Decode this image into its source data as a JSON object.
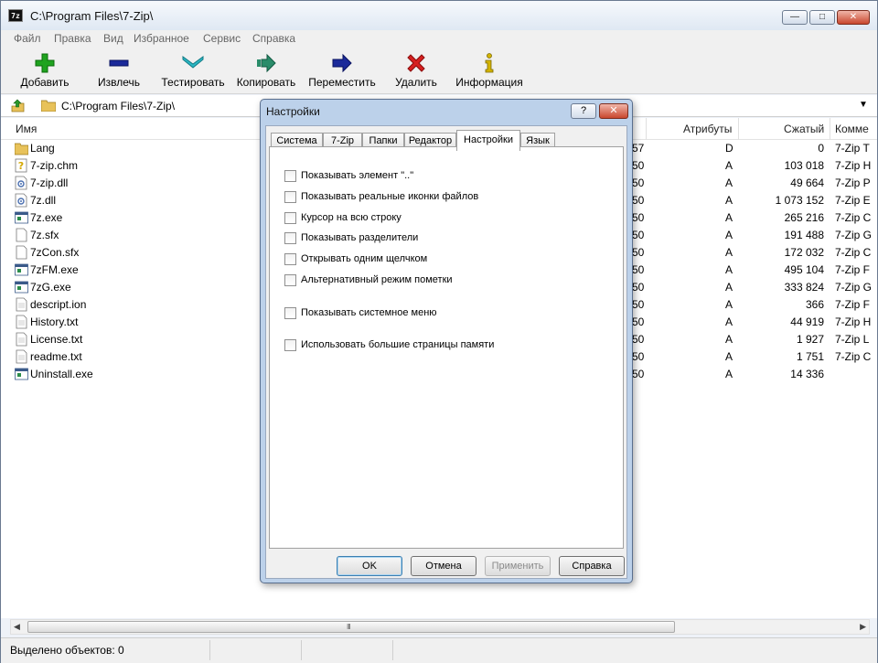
{
  "window": {
    "title": "C:\\Program Files\\7-Zip\\",
    "app_icon": "7z"
  },
  "menu": [
    "Файл",
    "Правка",
    "Вид",
    "Избранное",
    "Сервис",
    "Справка"
  ],
  "toolbar": [
    {
      "label": "Добавить",
      "icon": "plus-icon",
      "color": "#1fa31f"
    },
    {
      "label": "Извлечь",
      "icon": "minus-icon",
      "color": "#1b2a9a"
    },
    {
      "label": "Тестировать",
      "icon": "check-chevron-icon",
      "color": "#2bb7c4"
    },
    {
      "label": "Копировать",
      "icon": "copy-arrow-icon",
      "color": "#2a8c6a"
    },
    {
      "label": "Переместить",
      "icon": "move-arrow-icon",
      "color": "#1b2a9a"
    },
    {
      "label": "Удалить",
      "icon": "delete-x-icon",
      "color": "#d62020"
    },
    {
      "label": "Информация",
      "icon": "info-icon",
      "color": "#d4b400"
    }
  ],
  "address": {
    "path": "C:\\Program Files\\7-Zip\\"
  },
  "columns": {
    "name": "Имя",
    "attributes": "Атрибуты",
    "packed": "Сжатый",
    "comment": "Комме"
  },
  "files": [
    {
      "name": "Lang",
      "icon": "folder-icon",
      "modified": "57",
      "attr": "D",
      "size": "0",
      "comment": "7-Zip T"
    },
    {
      "name": "7-zip.chm",
      "icon": "help-file-icon",
      "modified": "50",
      "attr": "A",
      "size": "103 018",
      "comment": "7-Zip H"
    },
    {
      "name": "7-zip.dll",
      "icon": "dll-file-icon",
      "modified": "50",
      "attr": "A",
      "size": "49 664",
      "comment": "7-Zip P"
    },
    {
      "name": "7z.dll",
      "icon": "dll-file-icon",
      "modified": "50",
      "attr": "A",
      "size": "1 073 152",
      "comment": "7-Zip E"
    },
    {
      "name": "7z.exe",
      "icon": "exe-file-icon",
      "modified": "50",
      "attr": "A",
      "size": "265 216",
      "comment": "7-Zip C"
    },
    {
      "name": "7z.sfx",
      "icon": "blank-file-icon",
      "modified": "50",
      "attr": "A",
      "size": "191 488",
      "comment": "7-Zip G"
    },
    {
      "name": "7zCon.sfx",
      "icon": "blank-file-icon",
      "modified": "50",
      "attr": "A",
      "size": "172 032",
      "comment": "7-Zip C"
    },
    {
      "name": "7zFM.exe",
      "icon": "exe-file-icon",
      "modified": "50",
      "attr": "A",
      "size": "495 104",
      "comment": "7-Zip F"
    },
    {
      "name": "7zG.exe",
      "icon": "exe-file-icon",
      "modified": "50",
      "attr": "A",
      "size": "333 824",
      "comment": "7-Zip G"
    },
    {
      "name": "descript.ion",
      "icon": "text-file-icon",
      "modified": "50",
      "attr": "A",
      "size": "366",
      "comment": "7-Zip F"
    },
    {
      "name": "History.txt",
      "icon": "text-file-icon",
      "modified": "50",
      "attr": "A",
      "size": "44 919",
      "comment": "7-Zip H"
    },
    {
      "name": "License.txt",
      "icon": "text-file-icon",
      "modified": "50",
      "attr": "A",
      "size": "1 927",
      "comment": "7-Zip L"
    },
    {
      "name": "readme.txt",
      "icon": "text-file-icon",
      "modified": "50",
      "attr": "A",
      "size": "1 751",
      "comment": "7-Zip C"
    },
    {
      "name": "Uninstall.exe",
      "icon": "exe-file-icon",
      "modified": "50",
      "attr": "A",
      "size": "14 336",
      "comment": ""
    }
  ],
  "scrollbar": {
    "grip": "III"
  },
  "status": {
    "text": "Выделено объектов: 0"
  },
  "dialog": {
    "title": "Настройки",
    "help_button": "?",
    "close_button": "✕",
    "tabs": [
      "Система",
      "7-Zip",
      "Папки",
      "Редактор",
      "Настройки",
      "Язык"
    ],
    "active_tab": 4,
    "options": [
      {
        "label": "Показывать элемент \"..\"",
        "checked": false
      },
      {
        "label": "Показывать реальные иконки файлов",
        "checked": false
      },
      {
        "label": "Курсор на всю строку",
        "checked": false
      },
      {
        "label": "Показывать разделители",
        "checked": false
      },
      {
        "label": "Открывать одним щелчком",
        "checked": false
      },
      {
        "label": "Альтернативный режим пометки",
        "checked": false
      },
      {
        "label": "Показывать системное меню",
        "checked": false
      },
      {
        "label": "Использовать большие страницы памяти",
        "checked": false
      }
    ],
    "buttons": {
      "ok": "OK",
      "cancel": "Отмена",
      "apply": "Применить",
      "help": "Справка"
    }
  }
}
